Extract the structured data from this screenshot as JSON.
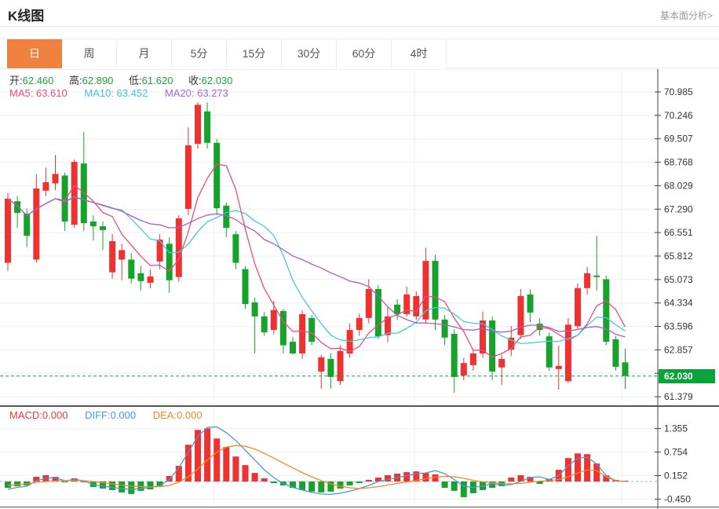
{
  "header": {
    "title": "K线图",
    "link": "基本面分析>"
  },
  "tabs": {
    "items": [
      {
        "label": "日",
        "active": true
      },
      {
        "label": "周",
        "active": false
      },
      {
        "label": "月",
        "active": false
      },
      {
        "label": "5分",
        "active": false
      },
      {
        "label": "15分",
        "active": false
      },
      {
        "label": "30分",
        "active": false
      },
      {
        "label": "60分",
        "active": false
      },
      {
        "label": "4时",
        "active": false
      }
    ]
  },
  "ohlc": {
    "open_label": "开:",
    "open_value": "62.460",
    "high_label": "高:",
    "high_value": "62.890",
    "low_label": "低:",
    "low_value": "61.620",
    "close_label": "收:",
    "close_value": "62.030"
  },
  "ma": {
    "ma5_label": "MA5: ",
    "ma5_value": "63.610",
    "ma10_label": "MA10: ",
    "ma10_value": "63.452",
    "ma20_label": "MA20: ",
    "ma20_value": "63.273"
  },
  "macd_panel": {
    "macd_label": "MACD:",
    "macd_value": "0.000",
    "diff_label": "DIFF:",
    "diff_value": "0.000",
    "dea_label": "DEA:",
    "dea_value": "0.000"
  },
  "price_badge": {
    "value": "62.030"
  },
  "colors": {
    "up": "#ee3232",
    "down": "#17a32b",
    "ma5": "#ef4a7c",
    "ma10": "#45c7dc",
    "ma20": "#a85ec4",
    "diff": "#4898e0",
    "dea": "#f6881f",
    "badge_green": "#0ba23c",
    "current_price_line": "#0ba23c",
    "tab_active": "#ef8240",
    "value_green": "#1ea33c",
    "grid": "#eeeeee",
    "axis": "#444444",
    "macd_zero_dash": "#8fb8e0"
  },
  "chart_data": {
    "type": "candlestick",
    "title": "K线图",
    "legend": [
      "MA5",
      "MA10",
      "MA20",
      "MACD",
      "DIFF",
      "DEA"
    ],
    "main": {
      "yticks": [
        "70.985",
        "70.246",
        "69.507",
        "68.768",
        "68.029",
        "67.290",
        "66.551",
        "65.812",
        "65.073",
        "64.334",
        "63.596",
        "62.857",
        null,
        "61.379"
      ],
      "ytick_step": 0.739,
      "ylim": [
        61.08,
        71.7
      ],
      "current_price": 62.03,
      "grid_x": [
        273,
        528,
        792
      ],
      "ma_windows": [
        5,
        10,
        20
      ],
      "candles_ohlc": [
        [
          65.6,
          67.8,
          65.35,
          67.62
        ],
        [
          67.54,
          67.7,
          66.7,
          67.17
        ],
        [
          67.15,
          67.3,
          66.1,
          66.45
        ],
        [
          65.7,
          68.4,
          65.6,
          67.94
        ],
        [
          67.87,
          68.6,
          67.7,
          68.14
        ],
        [
          68.1,
          69.0,
          67.9,
          68.4
        ],
        [
          68.35,
          68.45,
          66.6,
          66.9
        ],
        [
          66.8,
          68.85,
          66.7,
          68.78
        ],
        [
          68.73,
          69.72,
          66.6,
          66.85
        ],
        [
          66.9,
          67.1,
          66.3,
          66.75
        ],
        [
          66.75,
          66.9,
          66.0,
          66.63
        ],
        [
          65.3,
          66.5,
          65.1,
          66.28
        ],
        [
          65.7,
          66.2,
          65.05,
          66.0
        ],
        [
          65.7,
          65.9,
          64.95,
          65.1
        ],
        [
          65.27,
          65.5,
          64.72,
          65.02
        ],
        [
          64.97,
          65.4,
          64.8,
          65.17
        ],
        [
          65.64,
          66.5,
          65.4,
          66.33
        ],
        [
          66.2,
          66.4,
          64.65,
          65.05
        ],
        [
          65.15,
          67.1,
          65.0,
          67.0
        ],
        [
          67.3,
          69.87,
          67.1,
          69.3
        ],
        [
          69.35,
          70.66,
          69.2,
          70.58
        ],
        [
          70.37,
          70.66,
          69.2,
          69.38
        ],
        [
          69.38,
          69.5,
          67.1,
          67.32
        ],
        [
          67.4,
          67.5,
          66.4,
          66.7
        ],
        [
          66.5,
          66.6,
          65.4,
          65.6
        ],
        [
          65.4,
          65.5,
          64.15,
          64.3
        ],
        [
          64.35,
          64.5,
          62.74,
          63.91
        ],
        [
          63.91,
          64.05,
          63.3,
          63.41
        ],
        [
          63.48,
          64.4,
          63.35,
          64.11
        ],
        [
          64.08,
          64.15,
          62.74,
          63.0
        ],
        [
          63.11,
          63.25,
          62.7,
          62.74
        ],
        [
          62.74,
          64.1,
          62.57,
          63.98
        ],
        [
          63.86,
          63.95,
          63.0,
          63.11
        ],
        [
          62.17,
          62.7,
          61.63,
          62.62
        ],
        [
          62.57,
          62.75,
          61.63,
          62.0
        ],
        [
          61.87,
          63.0,
          61.75,
          62.82
        ],
        [
          62.74,
          63.68,
          62.6,
          63.48
        ],
        [
          63.48,
          64.0,
          63.3,
          63.86
        ],
        [
          63.86,
          65.08,
          63.7,
          64.77
        ],
        [
          64.77,
          64.9,
          63.2,
          63.28
        ],
        [
          63.32,
          64.2,
          63.1,
          63.91
        ],
        [
          64.28,
          64.45,
          63.8,
          63.98
        ],
        [
          63.98,
          64.85,
          63.9,
          64.6
        ],
        [
          63.91,
          64.7,
          63.8,
          64.55
        ],
        [
          63.81,
          66.08,
          63.7,
          65.66
        ],
        [
          65.66,
          65.85,
          63.48,
          63.81
        ],
        [
          63.81,
          63.95,
          63.0,
          63.24
        ],
        [
          63.36,
          63.5,
          61.5,
          62.0
        ],
        [
          62.05,
          62.6,
          61.9,
          62.44
        ],
        [
          62.37,
          62.85,
          62.2,
          62.74
        ],
        [
          62.74,
          64.06,
          62.6,
          63.78
        ],
        [
          63.78,
          63.9,
          61.9,
          62.17
        ],
        [
          62.3,
          62.7,
          61.75,
          62.57
        ],
        [
          62.86,
          63.6,
          62.66,
          63.24
        ],
        [
          63.32,
          64.77,
          63.2,
          64.55
        ],
        [
          64.6,
          64.75,
          63.73,
          64.03
        ],
        [
          63.68,
          63.85,
          63.3,
          63.48
        ],
        [
          63.28,
          63.4,
          62.2,
          62.3
        ],
        [
          62.25,
          62.99,
          61.6,
          62.35
        ],
        [
          61.87,
          63.86,
          61.8,
          63.65
        ],
        [
          63.6,
          64.95,
          63.5,
          64.8
        ],
        [
          64.8,
          65.47,
          64.6,
          65.27
        ],
        [
          65.2,
          66.45,
          64.72,
          65.15
        ],
        [
          65.08,
          65.2,
          63.0,
          63.11
        ],
        [
          63.19,
          63.3,
          62.2,
          62.32
        ],
        [
          62.46,
          62.89,
          61.62,
          62.03
        ]
      ]
    },
    "macd": {
      "yticks": [
        "1.355",
        "0.754",
        "0.152",
        "-0.450"
      ],
      "ylim": [
        -0.66,
        1.93
      ],
      "histogram": [
        -0.16,
        -0.12,
        -0.1,
        0.12,
        0.16,
        0.12,
        -0.02,
        0.08,
        -0.02,
        -0.14,
        -0.18,
        -0.22,
        -0.28,
        -0.32,
        -0.24,
        -0.2,
        -0.12,
        0.14,
        0.4,
        0.94,
        1.32,
        1.36,
        1.1,
        0.88,
        0.64,
        0.42,
        0.22,
        0.08,
        -0.04,
        -0.1,
        -0.16,
        -0.22,
        -0.26,
        -0.28,
        -0.26,
        -0.18,
        -0.1,
        -0.04,
        0.04,
        0.1,
        0.16,
        0.2,
        0.24,
        0.26,
        0.22,
        0.18,
        -0.16,
        -0.24,
        -0.4,
        -0.3,
        -0.22,
        -0.16,
        -0.12,
        0.1,
        0.16,
        0.12,
        -0.06,
        0.06,
        0.3,
        0.6,
        0.72,
        0.7,
        0.46,
        0.16,
        0.04,
        0.0
      ],
      "diff": [
        -0.2,
        -0.15,
        -0.12,
        0.02,
        0.08,
        0.1,
        0.02,
        0.05,
        0.02,
        -0.08,
        -0.12,
        -0.15,
        -0.18,
        -0.2,
        -0.18,
        -0.15,
        -0.1,
        0.05,
        0.35,
        0.75,
        1.15,
        1.38,
        1.4,
        1.25,
        1.05,
        0.8,
        0.55,
        0.3,
        0.1,
        -0.05,
        -0.15,
        -0.22,
        -0.28,
        -0.32,
        -0.33,
        -0.3,
        -0.25,
        -0.18,
        -0.1,
        0.0,
        0.05,
        0.1,
        0.15,
        0.2,
        0.22,
        0.28,
        0.2,
        0.05,
        -0.12,
        -0.15,
        -0.12,
        -0.05,
        -0.1,
        -0.08,
        0.0,
        0.1,
        0.12,
        0.05,
        0.15,
        0.4,
        0.6,
        0.62,
        0.45,
        0.15,
        0.02,
        0.0
      ],
      "dea": [
        -0.1,
        -0.08,
        -0.06,
        -0.02,
        0.0,
        0.02,
        0.02,
        0.03,
        0.02,
        0.0,
        -0.03,
        -0.06,
        -0.09,
        -0.12,
        -0.13,
        -0.14,
        -0.13,
        -0.1,
        -0.02,
        0.12,
        0.32,
        0.55,
        0.75,
        0.88,
        0.92,
        0.9,
        0.83,
        0.72,
        0.6,
        0.47,
        0.35,
        0.23,
        0.12,
        0.02,
        -0.06,
        -0.12,
        -0.16,
        -0.18,
        -0.16,
        -0.13,
        -0.09,
        -0.05,
        -0.01,
        0.03,
        0.07,
        0.11,
        0.13,
        0.12,
        0.08,
        0.03,
        -0.01,
        -0.03,
        -0.05,
        -0.06,
        -0.05,
        -0.02,
        0.01,
        0.02,
        0.05,
        0.12,
        0.22,
        0.3,
        0.28,
        0.12,
        0.02,
        0.0
      ]
    }
  }
}
